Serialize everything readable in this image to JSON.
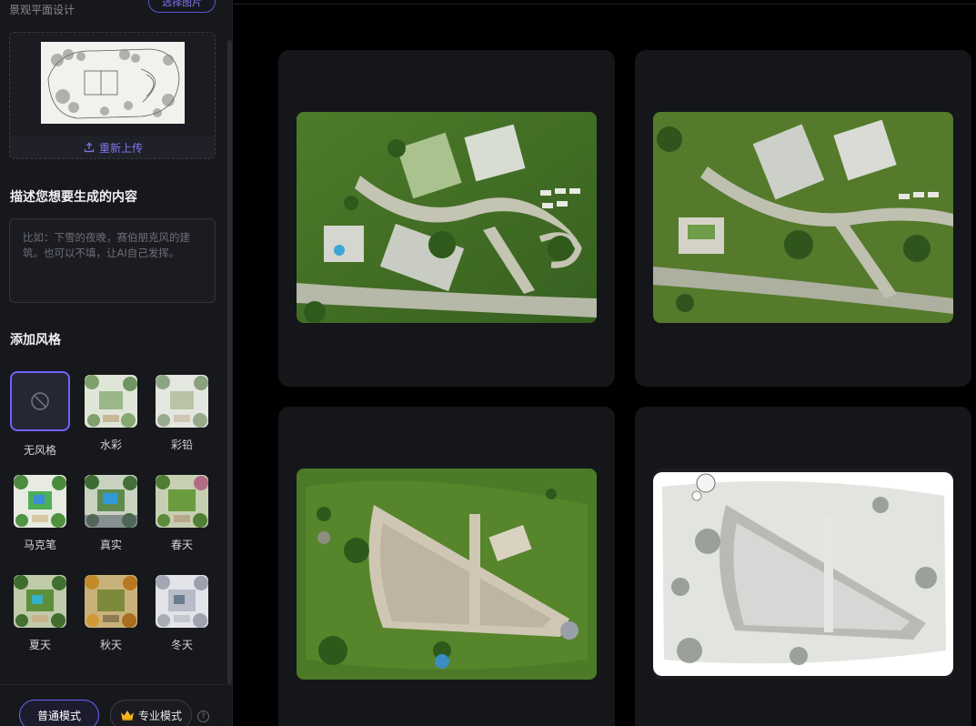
{
  "sidebar": {
    "top_label": "景观平面设计",
    "top_button": "选择图片",
    "reupload_label": "重新上传",
    "describe_title": "描述您想要生成的内容",
    "prompt_placeholder": "比如：下雪的夜晚，赛伯朋克风的建筑。也可以不填，让AI自己发挥。",
    "style_title": "添加风格",
    "styles": [
      {
        "label": "无风格",
        "selected": true
      },
      {
        "label": "水彩"
      },
      {
        "label": "彩铅"
      },
      {
        "label": "马克笔"
      },
      {
        "label": "真实"
      },
      {
        "label": "春天"
      },
      {
        "label": "夏天"
      },
      {
        "label": "秋天"
      },
      {
        "label": "冬天"
      }
    ],
    "mode_normal": "普通模式",
    "mode_pro": "专业模式",
    "help": "?"
  },
  "colors": {
    "accent": "#6c63ff",
    "sidebar_bg": "#17181c",
    "card_bg": "#15161a"
  },
  "results": [
    {
      "name": "result-image-1"
    },
    {
      "name": "result-image-2"
    },
    {
      "name": "result-image-3"
    },
    {
      "name": "result-image-4"
    }
  ]
}
